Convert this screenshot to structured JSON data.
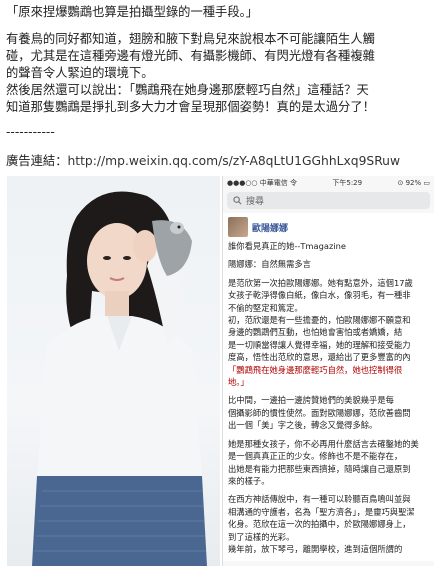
{
  "text": {
    "quote": "「原來捏爆鸚鵡也算是拍攝型錄的一種手段。」",
    "para1": [
      "有養鳥的同好都知道，翅膀和腋下對鳥兒來說根本不可能讓陌生人觸",
      "碰，尤其是在這種旁邊有燈光師、有攝影機師、有閃光燈有各種複雜",
      "的聲音令人緊迫的環境下。"
    ],
    "para2": [
      "然後居然還可以說出：「鸚鵡飛在她身邊那麼輕巧自然」這種話？天",
      "知道那隻鸚鵡是掙扎到多大力才會呈現那個姿勢！真的是太過分了！"
    ],
    "divider": "-----------",
    "ad_label": "廣告連結：",
    "ad_url": "http://mp.weixin.qq.com/s/zY-A8qLtU1GGhhLxq9SRuw"
  },
  "phone": {
    "status": {
      "carrier": "●●●○○ 中華電信 令",
      "time": "下午5:29",
      "battery": "⊙ 92% ▭"
    },
    "search_placeholder": "搜尋",
    "page_name": "歐陽娜娜",
    "lines": [
      "誰你看見真正的她--Tmagazine",
      "",
      "陽娜娜：自然無需多言",
      "",
      "是范欣第一次拍歐陽娜娜。她有點意外，這個17歲",
      "女孩子乾淨得像白紙，像白水，像羽毛，有一種非",
      "不偷的堅定和篤定。",
      "初，范欣還是有一些擔憂的，怕歐陽娜娜不願意和",
      "身邊的鸚鵡們互動，也怕她會害怕或者嬌嬌，結",
      "是一切順當得讓人覺得幸福，她的理解和接受能力",
      "度高，悟性出范欣的意思，還給出了更多豐富的內",
      "「鸚鵡飛在她身邊那麼輕巧自然，她也控制得很",
      "地。」",
      "",
      "比中間，一邊拍一邊誇贊她們的美貌幾乎是每",
      "個攝影師的慣性使然。面對歐陽娜娜，范欣善齒問",
      "出一個「美」字之後，轉念又覺得多餘。",
      "",
      "她是那種女孩子，你不必再用什麼話言去確鑿她的美",
      "是一個真真正正的少女。修飾也不是不能存在，",
      "出她是有能力把那些東西擠掉，隨時讓自己還原到",
      "來的樣子。",
      "",
      "在西方神話傳說中，有一種可以聆聽百鳥鳴叫並與",
      "相溝通的守護者，名為「聖方濟各」，是靈巧與聖潔",
      "化身。范欣在這一次的拍攝中，於歐陽娜娜身上，",
      "到了這樣的光彩。",
      "幾年前，放下琴弓，離開學校，進到這個所謂的"
    ],
    "highlight_index": 11
  }
}
